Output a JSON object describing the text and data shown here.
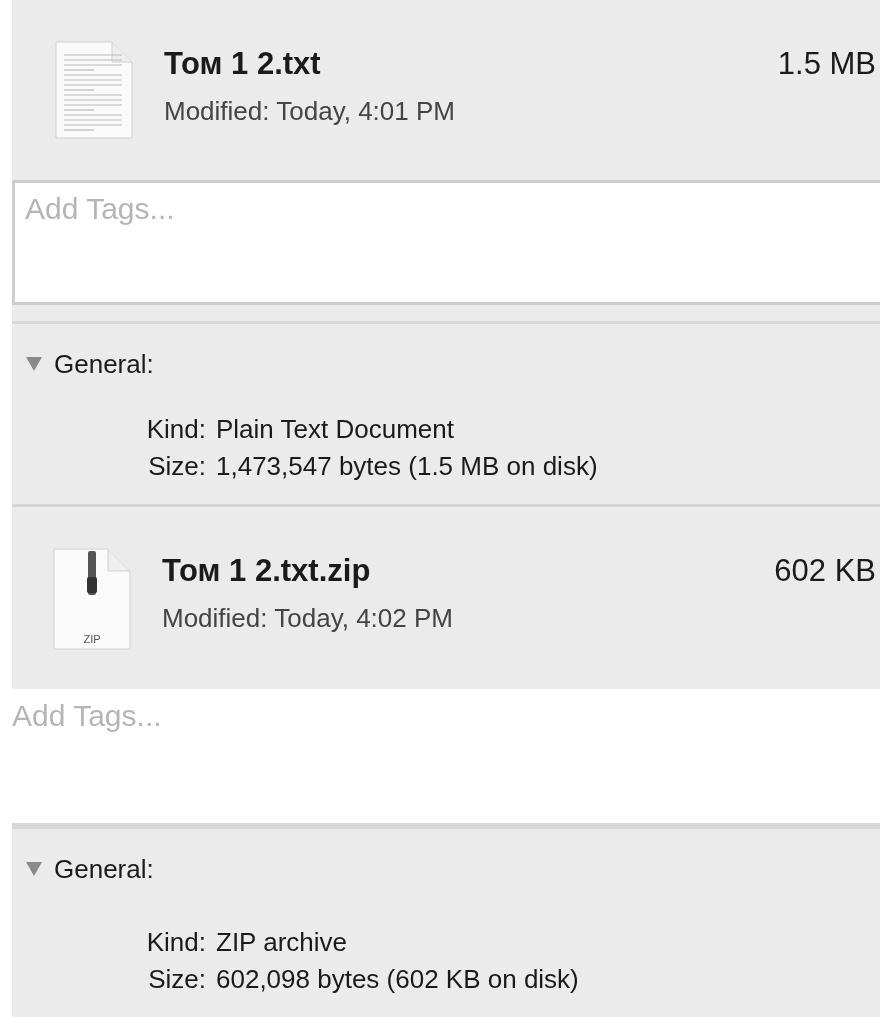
{
  "panels": [
    {
      "icon": {
        "kind": "text"
      },
      "name": "Том 1 2.txt",
      "size": "1.5 MB",
      "modified": "Modified: Today, 4:01 PM",
      "tags": {
        "placeholder": "Add Tags...",
        "bordered": true
      },
      "general": {
        "label": "General:",
        "expanded": true,
        "rows": [
          {
            "label": "Kind:",
            "value": "Plain Text Document"
          },
          {
            "label": "Size:",
            "value": "1,473,547 bytes (1.5 MB on disk)"
          }
        ]
      }
    },
    {
      "icon": {
        "kind": "zip",
        "label": "ZIP"
      },
      "name": "Том 1 2.txt.zip",
      "size": "602 KB",
      "modified": "Modified: Today, 4:02 PM",
      "tags": {
        "placeholder": "Add Tags...",
        "bordered": false
      },
      "general": {
        "label": "General:",
        "expanded": true,
        "rows": [
          {
            "label": "Kind:",
            "value": "ZIP archive"
          },
          {
            "label": "Size:",
            "value": "602,098 bytes (602 KB on disk)"
          }
        ]
      }
    }
  ]
}
